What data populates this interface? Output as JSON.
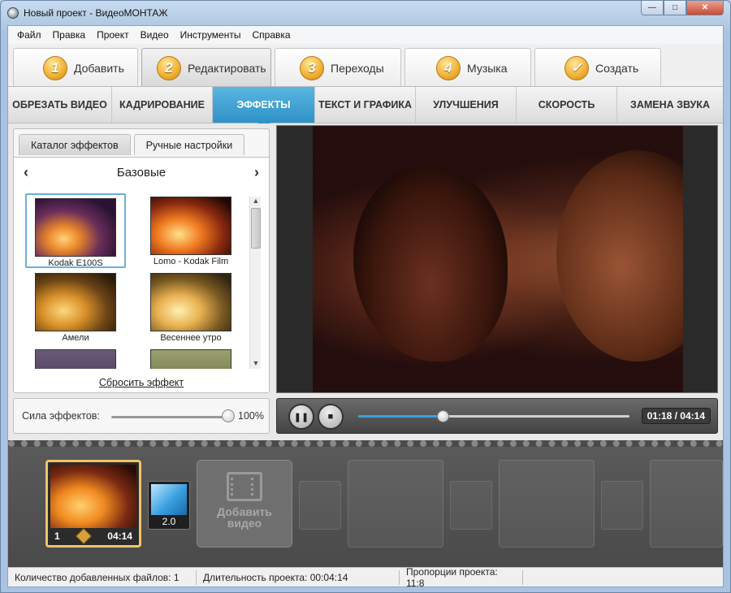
{
  "window": {
    "title": "Новый проект - ВидеоМОНТАЖ",
    "min": "—",
    "max": "□",
    "close": "✕"
  },
  "menu": [
    "Файл",
    "Правка",
    "Проект",
    "Видео",
    "Инструменты",
    "Справка"
  ],
  "steps": [
    {
      "num": "1",
      "label": "Добавить"
    },
    {
      "num": "2",
      "label": "Редактировать"
    },
    {
      "num": "3",
      "label": "Переходы"
    },
    {
      "num": "4",
      "label": "Музыка"
    },
    {
      "num": "✓",
      "label": "Создать"
    }
  ],
  "subtabs": [
    "ОБРЕЗАТЬ ВИДЕО",
    "КАДРИРОВАНИЕ",
    "ЭФФЕКТЫ",
    "ТЕКСТ И ГРАФИКА",
    "УЛУЧШЕНИЯ",
    "СКОРОСТЬ",
    "ЗАМЕНА ЗВУКА"
  ],
  "active_subtab": "ЭФФЕКТЫ",
  "effects_panel": {
    "tabs": [
      "Каталог эффектов",
      "Ручные настройки"
    ],
    "category": "Базовые",
    "prev": "‹",
    "next": "›",
    "effects": [
      "Kodak E100S",
      "Lomo - Kodak Film",
      "Амели",
      "Весеннее утро"
    ],
    "reset": "Сбросить эффект"
  },
  "strength": {
    "label": "Сила эффектов:",
    "value": "100%"
  },
  "player": {
    "time": "01:18 / 04:14",
    "progress": 0.31
  },
  "timeline": {
    "clip": {
      "index": "1",
      "duration": "04:14"
    },
    "transition": "2.0",
    "add_label_1": "Добавить",
    "add_label_2": "видео"
  },
  "status": {
    "files": "Количество добавленных файлов: 1",
    "duration": "Длительность проекта:  00:04:14",
    "ratio": "Пропорции проекта:  11:8"
  },
  "colors": {
    "accent": "#2d92c8",
    "badge": "#f3b43a",
    "clip_border": "#f0c46a"
  }
}
